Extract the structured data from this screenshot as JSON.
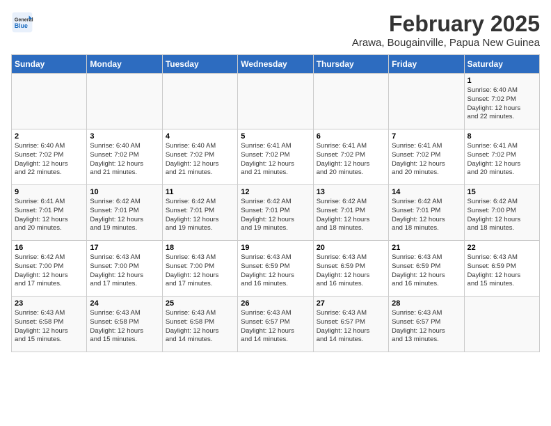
{
  "header": {
    "logo_line1": "General",
    "logo_line2": "Blue",
    "title": "February 2025",
    "subtitle": "Arawa, Bougainville, Papua New Guinea"
  },
  "days_of_week": [
    "Sunday",
    "Monday",
    "Tuesday",
    "Wednesday",
    "Thursday",
    "Friday",
    "Saturday"
  ],
  "weeks": [
    [
      {
        "day": "",
        "info": ""
      },
      {
        "day": "",
        "info": ""
      },
      {
        "day": "",
        "info": ""
      },
      {
        "day": "",
        "info": ""
      },
      {
        "day": "",
        "info": ""
      },
      {
        "day": "",
        "info": ""
      },
      {
        "day": "1",
        "info": "Sunrise: 6:40 AM\nSunset: 7:02 PM\nDaylight: 12 hours\nand 22 minutes."
      }
    ],
    [
      {
        "day": "2",
        "info": "Sunrise: 6:40 AM\nSunset: 7:02 PM\nDaylight: 12 hours\nand 22 minutes."
      },
      {
        "day": "3",
        "info": "Sunrise: 6:40 AM\nSunset: 7:02 PM\nDaylight: 12 hours\nand 21 minutes."
      },
      {
        "day": "4",
        "info": "Sunrise: 6:40 AM\nSunset: 7:02 PM\nDaylight: 12 hours\nand 21 minutes."
      },
      {
        "day": "5",
        "info": "Sunrise: 6:41 AM\nSunset: 7:02 PM\nDaylight: 12 hours\nand 21 minutes."
      },
      {
        "day": "6",
        "info": "Sunrise: 6:41 AM\nSunset: 7:02 PM\nDaylight: 12 hours\nand 20 minutes."
      },
      {
        "day": "7",
        "info": "Sunrise: 6:41 AM\nSunset: 7:02 PM\nDaylight: 12 hours\nand 20 minutes."
      },
      {
        "day": "8",
        "info": "Sunrise: 6:41 AM\nSunset: 7:02 PM\nDaylight: 12 hours\nand 20 minutes."
      }
    ],
    [
      {
        "day": "9",
        "info": "Sunrise: 6:41 AM\nSunset: 7:01 PM\nDaylight: 12 hours\nand 20 minutes."
      },
      {
        "day": "10",
        "info": "Sunrise: 6:42 AM\nSunset: 7:01 PM\nDaylight: 12 hours\nand 19 minutes."
      },
      {
        "day": "11",
        "info": "Sunrise: 6:42 AM\nSunset: 7:01 PM\nDaylight: 12 hours\nand 19 minutes."
      },
      {
        "day": "12",
        "info": "Sunrise: 6:42 AM\nSunset: 7:01 PM\nDaylight: 12 hours\nand 19 minutes."
      },
      {
        "day": "13",
        "info": "Sunrise: 6:42 AM\nSunset: 7:01 PM\nDaylight: 12 hours\nand 18 minutes."
      },
      {
        "day": "14",
        "info": "Sunrise: 6:42 AM\nSunset: 7:01 PM\nDaylight: 12 hours\nand 18 minutes."
      },
      {
        "day": "15",
        "info": "Sunrise: 6:42 AM\nSunset: 7:00 PM\nDaylight: 12 hours\nand 18 minutes."
      }
    ],
    [
      {
        "day": "16",
        "info": "Sunrise: 6:42 AM\nSunset: 7:00 PM\nDaylight: 12 hours\nand 17 minutes."
      },
      {
        "day": "17",
        "info": "Sunrise: 6:43 AM\nSunset: 7:00 PM\nDaylight: 12 hours\nand 17 minutes."
      },
      {
        "day": "18",
        "info": "Sunrise: 6:43 AM\nSunset: 7:00 PM\nDaylight: 12 hours\nand 17 minutes."
      },
      {
        "day": "19",
        "info": "Sunrise: 6:43 AM\nSunset: 6:59 PM\nDaylight: 12 hours\nand 16 minutes."
      },
      {
        "day": "20",
        "info": "Sunrise: 6:43 AM\nSunset: 6:59 PM\nDaylight: 12 hours\nand 16 minutes."
      },
      {
        "day": "21",
        "info": "Sunrise: 6:43 AM\nSunset: 6:59 PM\nDaylight: 12 hours\nand 16 minutes."
      },
      {
        "day": "22",
        "info": "Sunrise: 6:43 AM\nSunset: 6:59 PM\nDaylight: 12 hours\nand 15 minutes."
      }
    ],
    [
      {
        "day": "23",
        "info": "Sunrise: 6:43 AM\nSunset: 6:58 PM\nDaylight: 12 hours\nand 15 minutes."
      },
      {
        "day": "24",
        "info": "Sunrise: 6:43 AM\nSunset: 6:58 PM\nDaylight: 12 hours\nand 15 minutes."
      },
      {
        "day": "25",
        "info": "Sunrise: 6:43 AM\nSunset: 6:58 PM\nDaylight: 12 hours\nand 14 minutes."
      },
      {
        "day": "26",
        "info": "Sunrise: 6:43 AM\nSunset: 6:57 PM\nDaylight: 12 hours\nand 14 minutes."
      },
      {
        "day": "27",
        "info": "Sunrise: 6:43 AM\nSunset: 6:57 PM\nDaylight: 12 hours\nand 14 minutes."
      },
      {
        "day": "28",
        "info": "Sunrise: 6:43 AM\nSunset: 6:57 PM\nDaylight: 12 hours\nand 13 minutes."
      },
      {
        "day": "",
        "info": ""
      }
    ]
  ]
}
